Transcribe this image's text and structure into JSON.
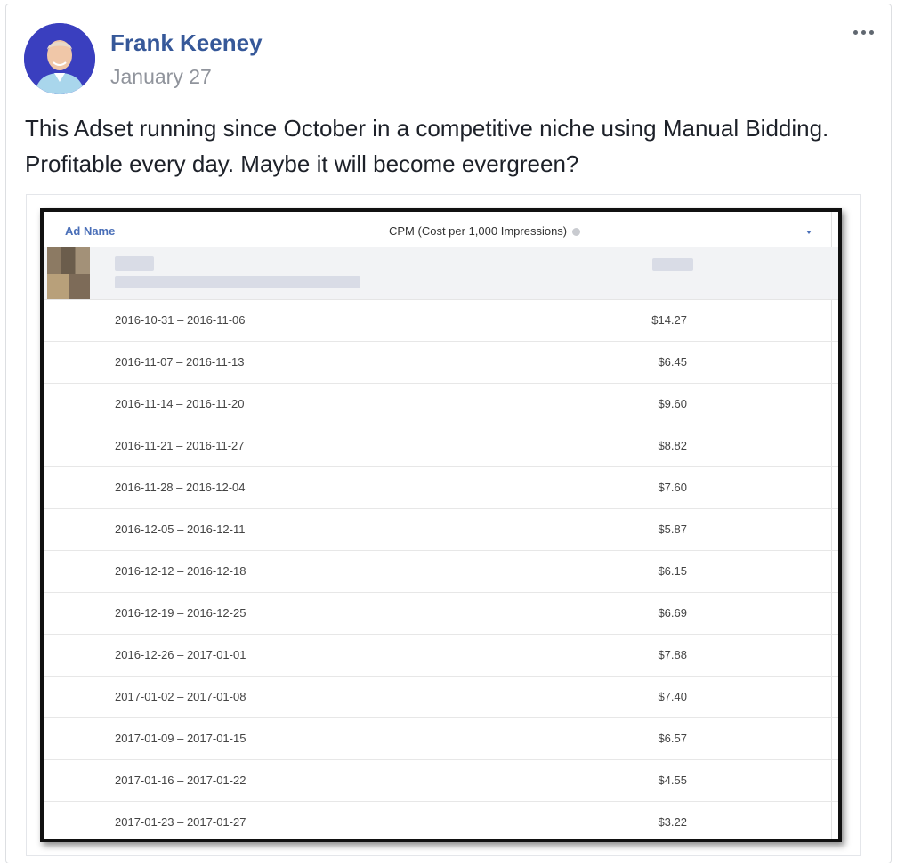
{
  "post": {
    "author": "Frank Keeney",
    "date": "January 27",
    "text": "This Adset running since October in a competitive niche using Manual Bidding. Profitable every day. Maybe it will become evergreen?",
    "more_icon": "ellipsis-icon"
  },
  "table": {
    "header": {
      "ad_name": "Ad Name",
      "cpm": "CPM (Cost per 1,000 Impressions)",
      "info_icon": "info-icon",
      "sort_icon": "sort-caret-icon"
    },
    "rows": [
      {
        "date_range": "2016-10-31 – 2016-11-06",
        "cpm": "$14.27"
      },
      {
        "date_range": "2016-11-07 – 2016-11-13",
        "cpm": "$6.45"
      },
      {
        "date_range": "2016-11-14 – 2016-11-20",
        "cpm": "$9.60"
      },
      {
        "date_range": "2016-11-21 – 2016-11-27",
        "cpm": "$8.82"
      },
      {
        "date_range": "2016-11-28 – 2016-12-04",
        "cpm": "$7.60"
      },
      {
        "date_range": "2016-12-05 – 2016-12-11",
        "cpm": "$5.87"
      },
      {
        "date_range": "2016-12-12 – 2016-12-18",
        "cpm": "$6.15"
      },
      {
        "date_range": "2016-12-19 – 2016-12-25",
        "cpm": "$6.69"
      },
      {
        "date_range": "2016-12-26 – 2017-01-01",
        "cpm": "$7.88"
      },
      {
        "date_range": "2017-01-02 – 2017-01-08",
        "cpm": "$7.40"
      },
      {
        "date_range": "2017-01-09 – 2017-01-15",
        "cpm": "$6.57"
      },
      {
        "date_range": "2017-01-16 – 2017-01-22",
        "cpm": "$4.55"
      },
      {
        "date_range": "2017-01-23 – 2017-01-27",
        "cpm": "$3.22"
      }
    ]
  },
  "colors": {
    "author_link": "#365899",
    "date_gray": "#90949c",
    "text": "#1d2129",
    "header_link": "#4a6fb8",
    "avatar_bg": "#3a3fbf"
  }
}
